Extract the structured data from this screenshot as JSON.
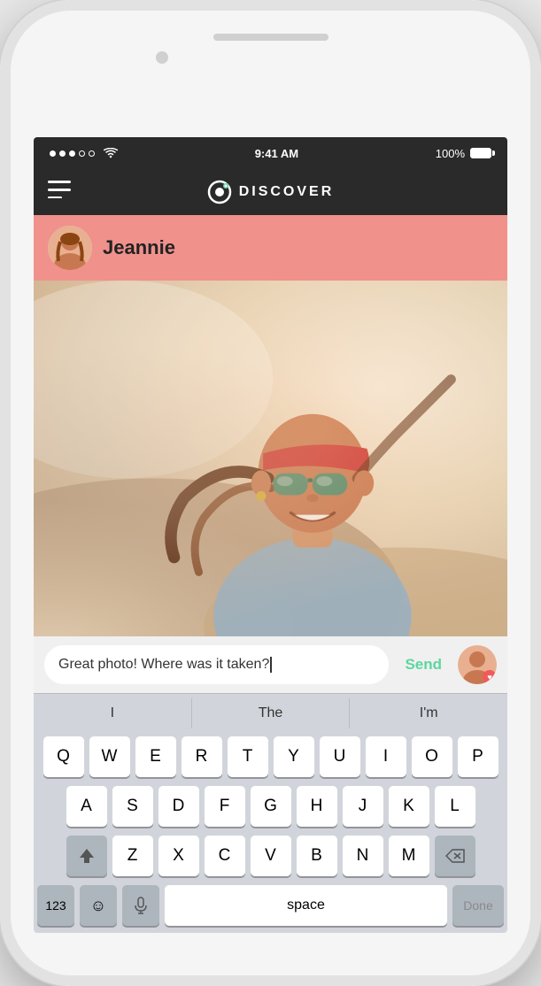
{
  "phone": {
    "status_bar": {
      "time": "9:41 AM",
      "battery": "100%",
      "signal_dots": [
        "filled",
        "filled",
        "filled",
        "empty",
        "empty"
      ]
    },
    "nav": {
      "left_icon": "menu-icon",
      "logo_icon": "app-logo-icon",
      "title": "DISCOVER"
    },
    "user_card": {
      "name": "Jeannie",
      "avatar_alt": "Jeannie avatar"
    },
    "message": {
      "text": "Great photo! Where was it taken?",
      "send_label": "Send",
      "avatar_alt": "My avatar"
    },
    "autocomplete": {
      "items": [
        "I",
        "The",
        "I'm"
      ]
    },
    "keyboard": {
      "rows": [
        [
          "Q",
          "W",
          "E",
          "R",
          "T",
          "Y",
          "U",
          "I",
          "O",
          "P"
        ],
        [
          "A",
          "S",
          "D",
          "F",
          "G",
          "H",
          "J",
          "K",
          "L"
        ],
        [
          "Z",
          "X",
          "C",
          "V",
          "B",
          "N",
          "M"
        ]
      ],
      "bottom": {
        "num_label": "123",
        "emoji_icon": "emoji-icon",
        "mic_icon": "microphone-icon",
        "space_label": "space",
        "done_label": "Done"
      }
    }
  }
}
